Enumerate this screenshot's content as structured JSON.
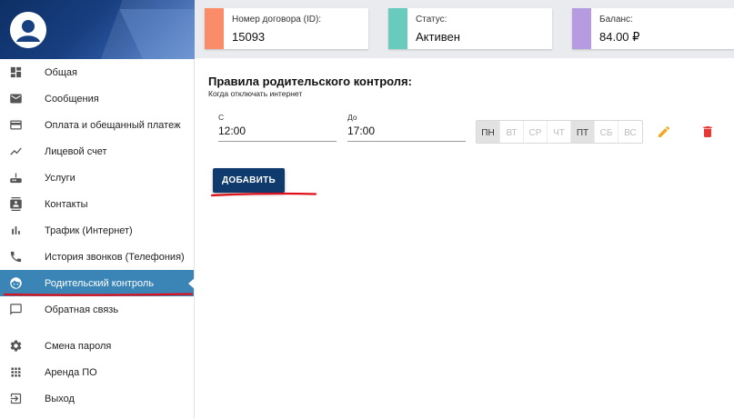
{
  "info_cards": [
    {
      "label": "Номер договора (ID):",
      "value": "15093",
      "color": "#fb8c6a"
    },
    {
      "label": "Статус:",
      "value": "Активен",
      "color": "#68cbbd"
    },
    {
      "label": "Баланс:",
      "value": "84.00 ₽",
      "color": "#b79be0"
    }
  ],
  "sidebar": {
    "items": [
      {
        "label": "Общая",
        "icon": "dashboard-icon"
      },
      {
        "label": "Сообщения",
        "icon": "mail-icon"
      },
      {
        "label": "Оплата и обещанный платеж",
        "icon": "credit-card-icon"
      },
      {
        "label": "Лицевой счет",
        "icon": "trending-icon"
      },
      {
        "label": "Услуги",
        "icon": "router-icon"
      },
      {
        "label": "Контакты",
        "icon": "contacts-icon"
      },
      {
        "label": "Трафик (Интернет)",
        "icon": "bar-chart-icon"
      },
      {
        "label": "История звонков (Телефония)",
        "icon": "phone-icon"
      },
      {
        "label": "Родительский контроль",
        "icon": "child-face-icon",
        "active": true
      },
      {
        "label": "Обратная связь",
        "icon": "feedback-icon"
      },
      {
        "label": "Смена пароля",
        "icon": "settings-icon"
      },
      {
        "label": "Аренда ПО",
        "icon": "apps-grid-icon"
      },
      {
        "label": "Выход",
        "icon": "exit-icon"
      }
    ],
    "active_color": "#3b84b6"
  },
  "main": {
    "title": "Правила родительского контроля:",
    "subtitle": "Когда отключать интернет",
    "rule": {
      "from_label": "С",
      "from_value": "12:00",
      "to_label": "До",
      "to_value": "17:00",
      "days": [
        {
          "label": "ПН",
          "selected": true
        },
        {
          "label": "ВТ",
          "selected": false
        },
        {
          "label": "СР",
          "selected": false
        },
        {
          "label": "ЧТ",
          "selected": false
        },
        {
          "label": "ПТ",
          "selected": true
        },
        {
          "label": "СБ",
          "selected": false
        },
        {
          "label": "ВС",
          "selected": false
        }
      ]
    },
    "add_button": "ДОБАВИТЬ"
  },
  "colors": {
    "header_blue": "#183f80",
    "button_blue": "#0e3a6e",
    "edit_orange": "#f5a623",
    "delete_red": "#e53935",
    "annotation_red": "#e0101a"
  }
}
